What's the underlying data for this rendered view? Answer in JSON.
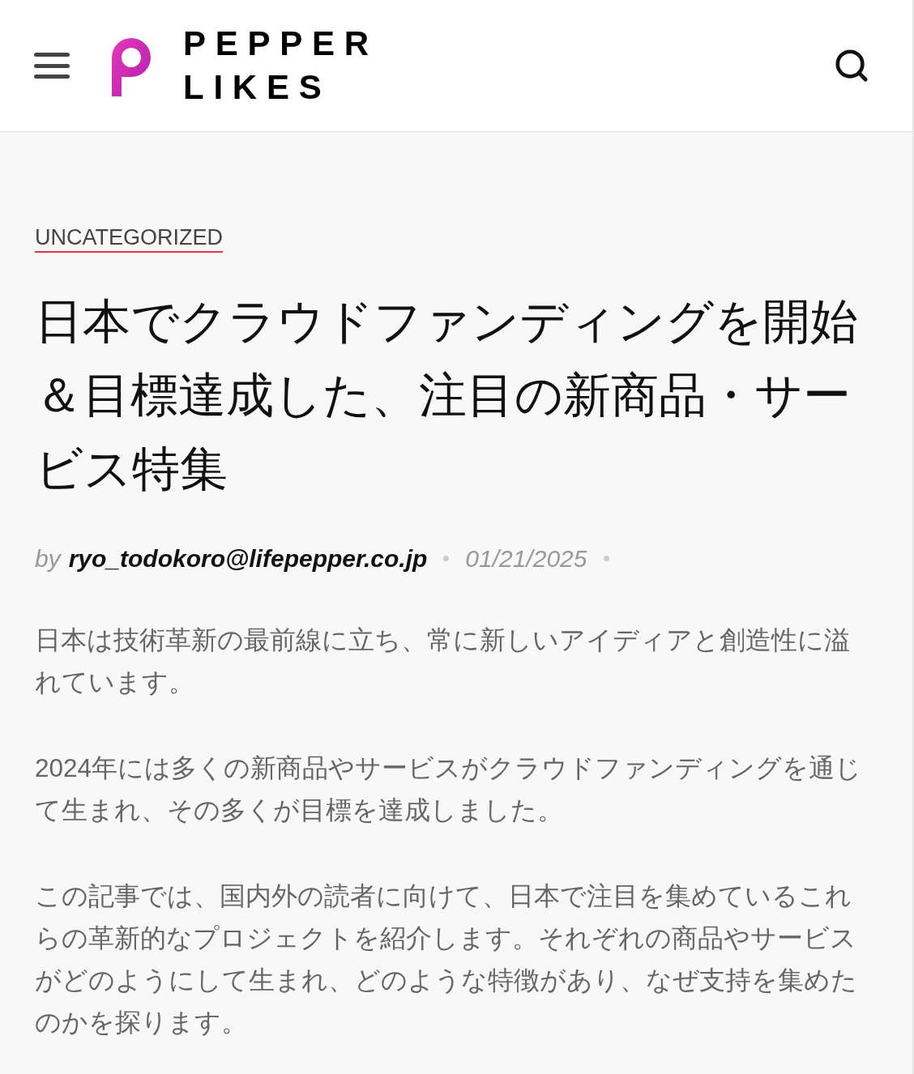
{
  "header": {
    "brand": [
      "PEPPER",
      "LIKES"
    ]
  },
  "article": {
    "category": "UNCATEGORIZED",
    "title": "日本でクラウドファンディングを開始＆目標達成した、注目の新商品・サービス特集",
    "byline": {
      "prefix": "by",
      "author": "ryo_todokoro@lifepepper.co.jp",
      "date": "01/21/2025"
    },
    "paragraphs": [
      "日本は技術革新の最前線に立ち、常に新しいアイディアと創造性に溢れています。",
      "2024年には多くの新商品やサービスがクラウドファンディングを通じて生まれ、その多くが目標を達成しました。",
      "この記事では、国内外の読者に向けて、日本で注目を集めているこれらの革新的なプロジェクトを紹介します。それぞれの商品やサービスがどのようにして生まれ、どのような特徴があり、なぜ支持を集めたのかを探ります。"
    ]
  }
}
